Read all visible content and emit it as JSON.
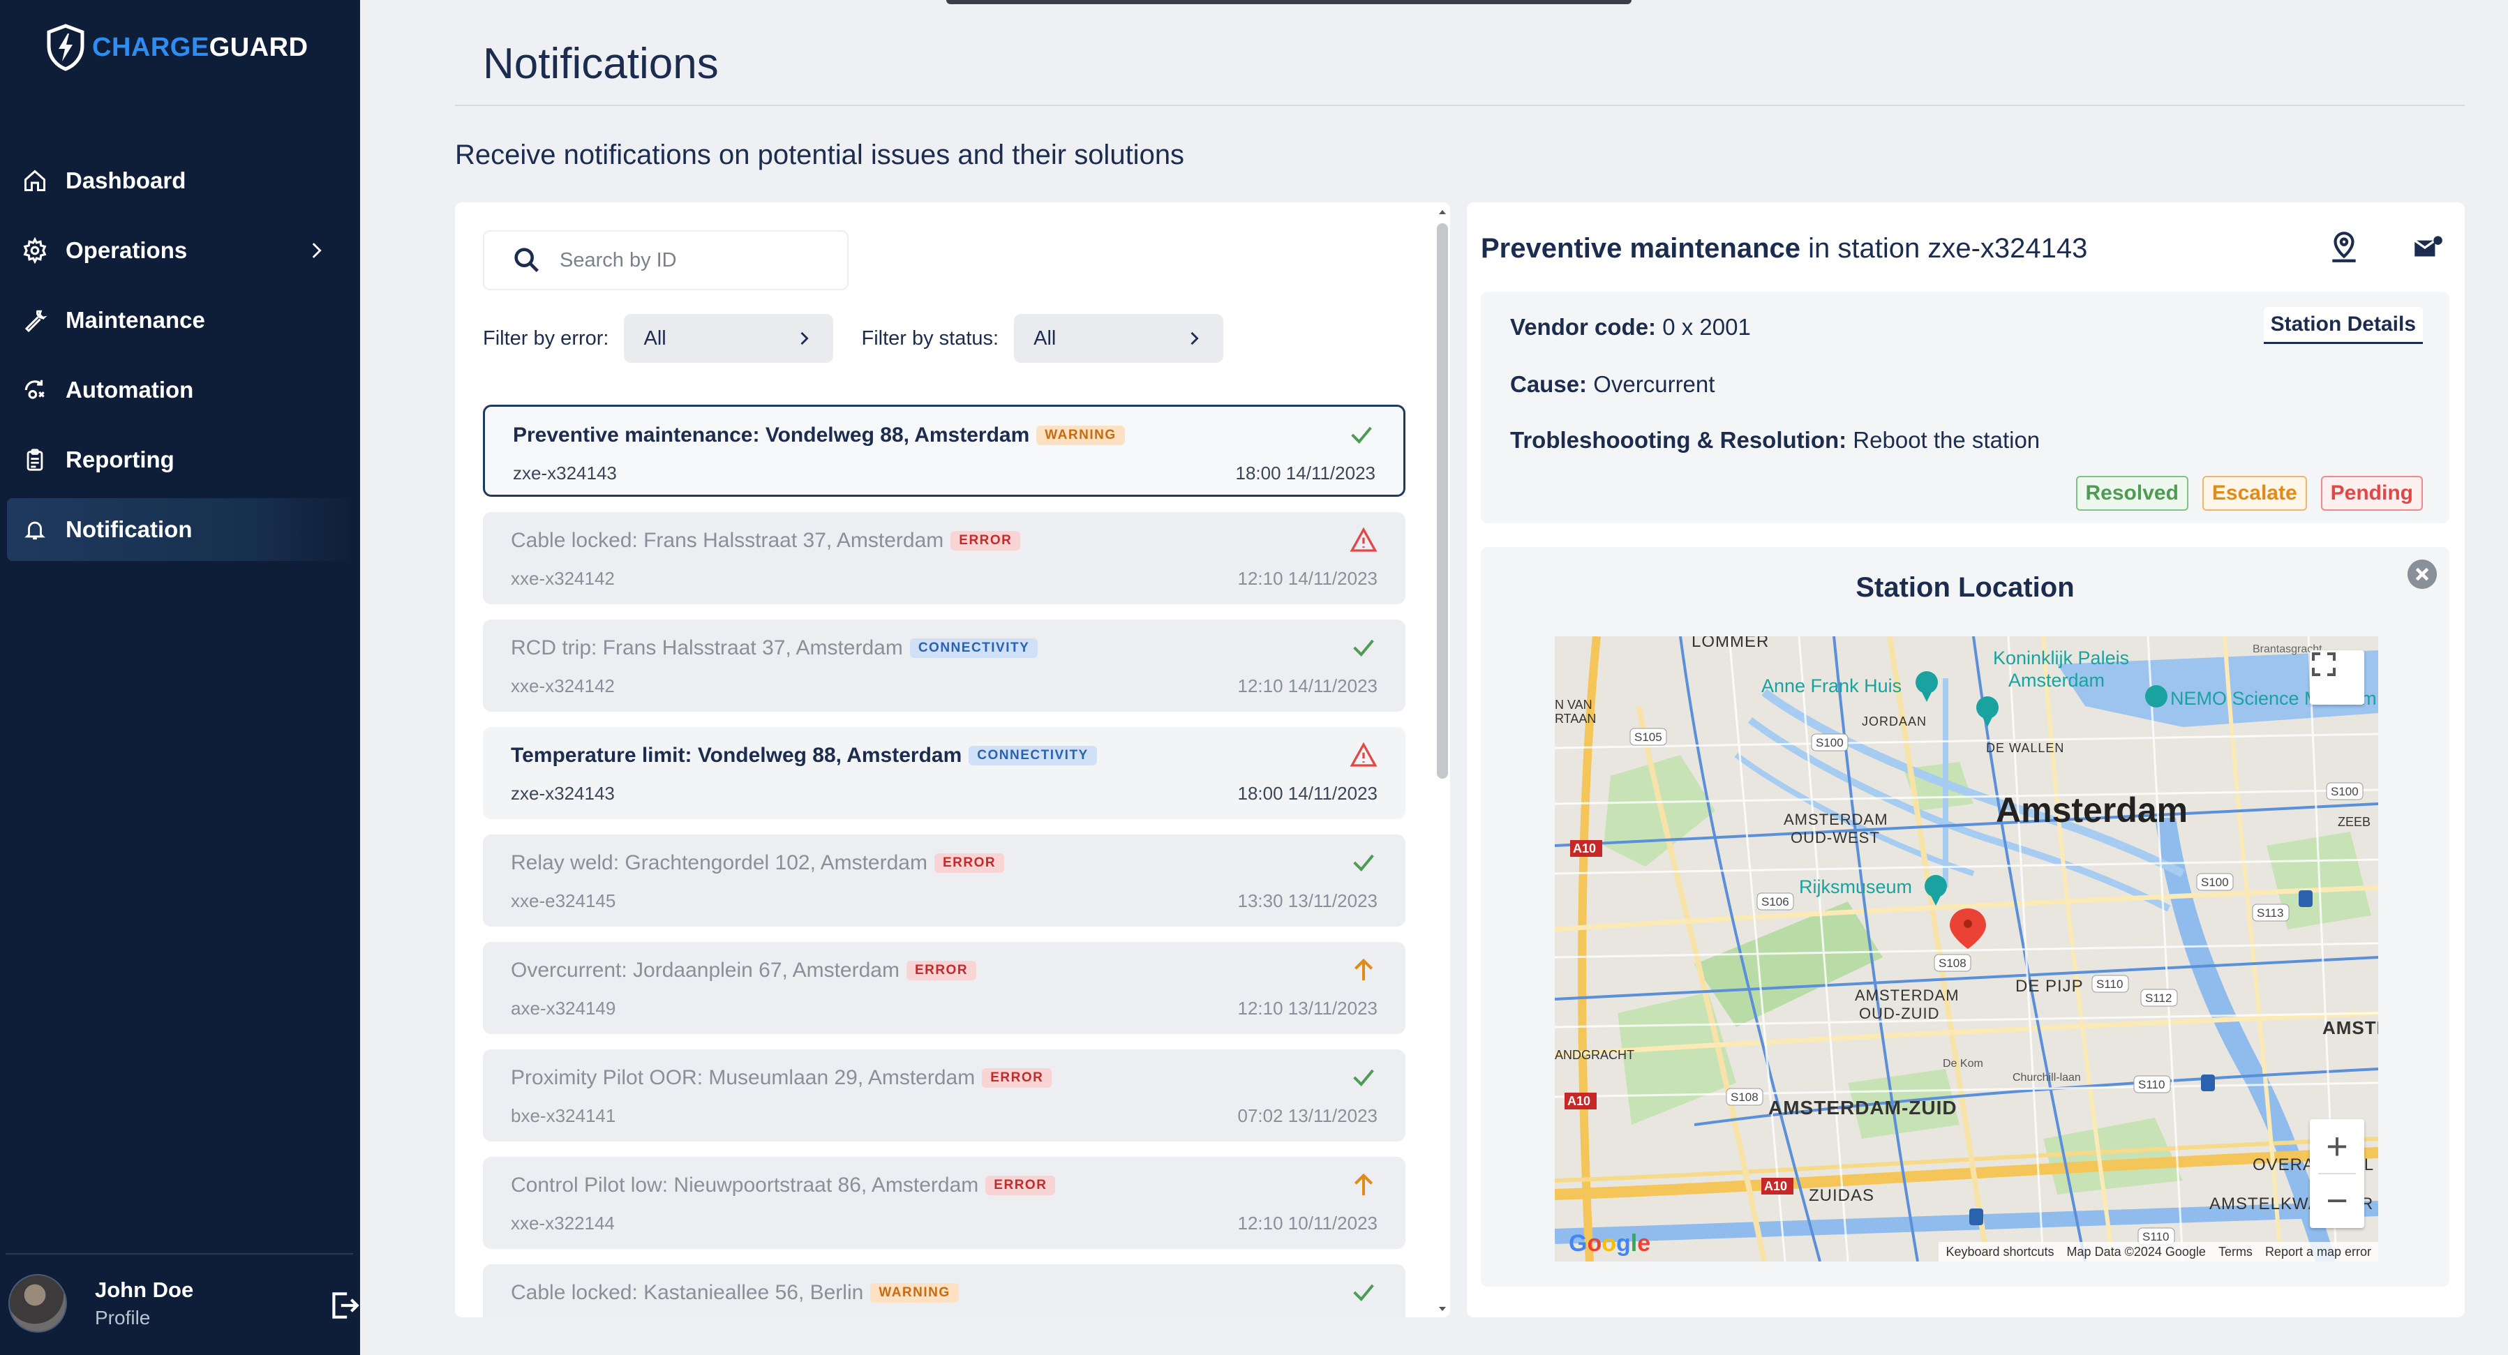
{
  "brand": {
    "part1": "CHARGE",
    "part2": "GUARD"
  },
  "sidebar": {
    "items": [
      {
        "label": "Dashboard",
        "icon": "home-icon"
      },
      {
        "label": "Operations",
        "icon": "gear-icon",
        "has_submenu": true
      },
      {
        "label": "Maintenance",
        "icon": "wrench-icon"
      },
      {
        "label": "Automation",
        "icon": "automation-icon"
      },
      {
        "label": "Reporting",
        "icon": "clipboard-icon"
      },
      {
        "label": "Notification",
        "icon": "bell-icon",
        "active": true
      }
    ],
    "user": {
      "name": "John Doe",
      "role": "Profile"
    }
  },
  "page": {
    "title": "Notifications",
    "subtitle": "Receive notifications on potential issues and their solutions"
  },
  "search": {
    "placeholder": "Search by ID"
  },
  "filters": {
    "error_label": "Filter by error:",
    "error_value": "All",
    "status_label": "Filter by status:",
    "status_value": "All"
  },
  "notifications": [
    {
      "title": "Preventive maintenance: Vondelweg 88, Amsterdam",
      "badge": "WARNING",
      "type": "warning",
      "id": "zxe-x324143",
      "time": "18:00 14/11/2023",
      "status": "resolved"
    },
    {
      "title": "Cable locked: Frans Halsstraat 37, Amsterdam",
      "badge": "ERROR",
      "type": "error",
      "id": "xxe-x324142",
      "time": "12:10 14/11/2023",
      "status": "alert"
    },
    {
      "title": "RCD trip: Frans Halsstraat 37, Amsterdam",
      "badge": "CONNECTIVITY",
      "type": "connectivity",
      "id": "xxe-x324142",
      "time": "12:10 14/11/2023",
      "status": "resolved"
    },
    {
      "title": "Temperature limit: Vondelweg 88, Amsterdam",
      "badge": "CONNECTIVITY",
      "type": "connectivity",
      "id": "zxe-x324143",
      "time": "18:00 14/11/2023",
      "status": "alert"
    },
    {
      "title": "Relay weld: Grachtengordel 102, Amsterdam",
      "badge": "ERROR",
      "type": "error",
      "id": "xxe-e324145",
      "time": "13:30 13/11/2023",
      "status": "resolved"
    },
    {
      "title": "Overcurrent: Jordaanplein 67, Amsterdam",
      "badge": "ERROR",
      "type": "error",
      "id": "axe-x324149",
      "time": "12:10 13/11/2023",
      "status": "escalated"
    },
    {
      "title": "Proximity Pilot OOR: Museumlaan 29, Amsterdam",
      "badge": "ERROR",
      "type": "error",
      "id": "bxe-x324141",
      "time": "07:02 13/11/2023",
      "status": "resolved"
    },
    {
      "title": "Control Pilot low: Nieuwpoortstraat 86, Amsterdam",
      "badge": "ERROR",
      "type": "error",
      "id": "xxe-x322144",
      "time": "12:10 10/11/2023",
      "status": "escalated"
    },
    {
      "title": "Cable locked: Kastanieallee 56, Berlin",
      "badge": "WARNING",
      "type": "warning",
      "id": "",
      "time": "",
      "status": "resolved"
    }
  ],
  "detail": {
    "title_bold": "Preventive maintenance",
    "title_rest": " in station zxe-x324143",
    "vendor_label": "Vendor code:",
    "vendor_value": " 0 x 2001",
    "cause_label": "Cause:",
    "cause_value": " Overcurrent",
    "trouble_label": "Trobleshoooting & Resolution:",
    "trouble_value": " Reboot the station",
    "station_details": "Station Details",
    "buttons": {
      "resolved": "Resolved",
      "escalate": "Escalate",
      "pending": "Pending"
    }
  },
  "location": {
    "title": "Station Location",
    "map_labels": {
      "amsterdam": "Amsterdam",
      "lommer": "LOMMER",
      "anne_frank": "Anne Frank Huis",
      "paleis1": "Koninklijk Paleis",
      "paleis2": "Amsterdam",
      "nemo": "NEMO Science Museum",
      "rijksmuseum": "Rijksmuseum",
      "oud_west1": "AMSTERDAM",
      "oud_west2": "OUD-WEST",
      "oud_zuid1": "AMSTERDAM",
      "oud_zuid2": "OUD-ZUID",
      "de_pijp": "DE PIJP",
      "zuid": "AMSTERDAM-ZUID",
      "zuidas": "ZUIDAS",
      "oost": "AMSTERDAM",
      "overamstel": "OVERAMSTEL",
      "amstelkwartier": "AMSTELKWARTIER",
      "jordaan": "JORDAAN",
      "de_wallen": "DE WALLEN",
      "zeeb": "ZEEB",
      "van": "N VAN",
      "rtaan": "RTAAN",
      "andgracht": "ANDGRACHT",
      "brantasgracht": "Brantasgracht",
      "a10": "A10",
      "s100": "S100",
      "s105": "S105",
      "s106": "S106",
      "s108": "S108",
      "s110": "S110",
      "s112": "S112",
      "s113": "S113",
      "de_kom": "De Kom",
      "churchill": "Churchill-laan"
    },
    "attribution": {
      "shortcuts": "Keyboard shortcuts",
      "data": "Map Data ©2024 Google",
      "terms": "Terms",
      "report": "Report a map error"
    },
    "google": "Google"
  },
  "colors": {
    "sidebar_bg": "#0f1e38",
    "brand_blue": "#2f8cf0",
    "resolved_green": "#4e9b53",
    "escalate_orange": "#e08a1a",
    "pending_red": "#e14747"
  }
}
